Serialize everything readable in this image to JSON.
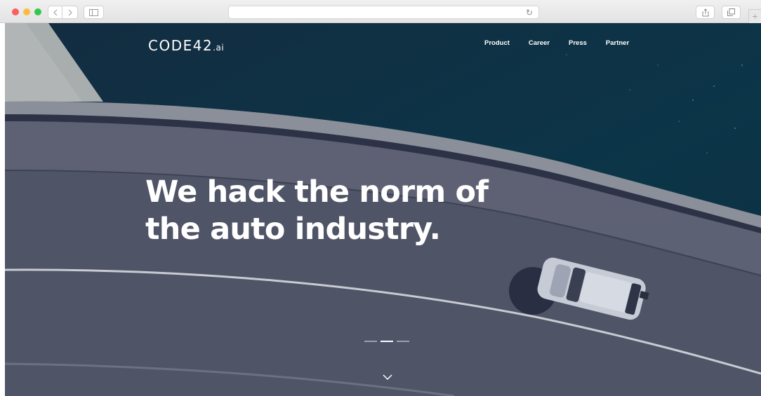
{
  "browser": {
    "address_text": "",
    "reload_icon": "reload-icon",
    "new_tab_icon": "plus-icon"
  },
  "site": {
    "logo_main": "CODE42",
    "logo_suffix": ".ai",
    "nav": [
      {
        "label": "Product"
      },
      {
        "label": "Career"
      },
      {
        "label": "Press"
      },
      {
        "label": "Partner"
      }
    ],
    "headline_line1": "We hack the norm of",
    "headline_line2": "the auto industry.",
    "slider": {
      "count": 3,
      "active_index": 1
    },
    "scroll_icon": "chevron-down-icon"
  },
  "colors": {
    "water": "#0f3445",
    "road": "#4b5163",
    "text": "#ffffff"
  }
}
